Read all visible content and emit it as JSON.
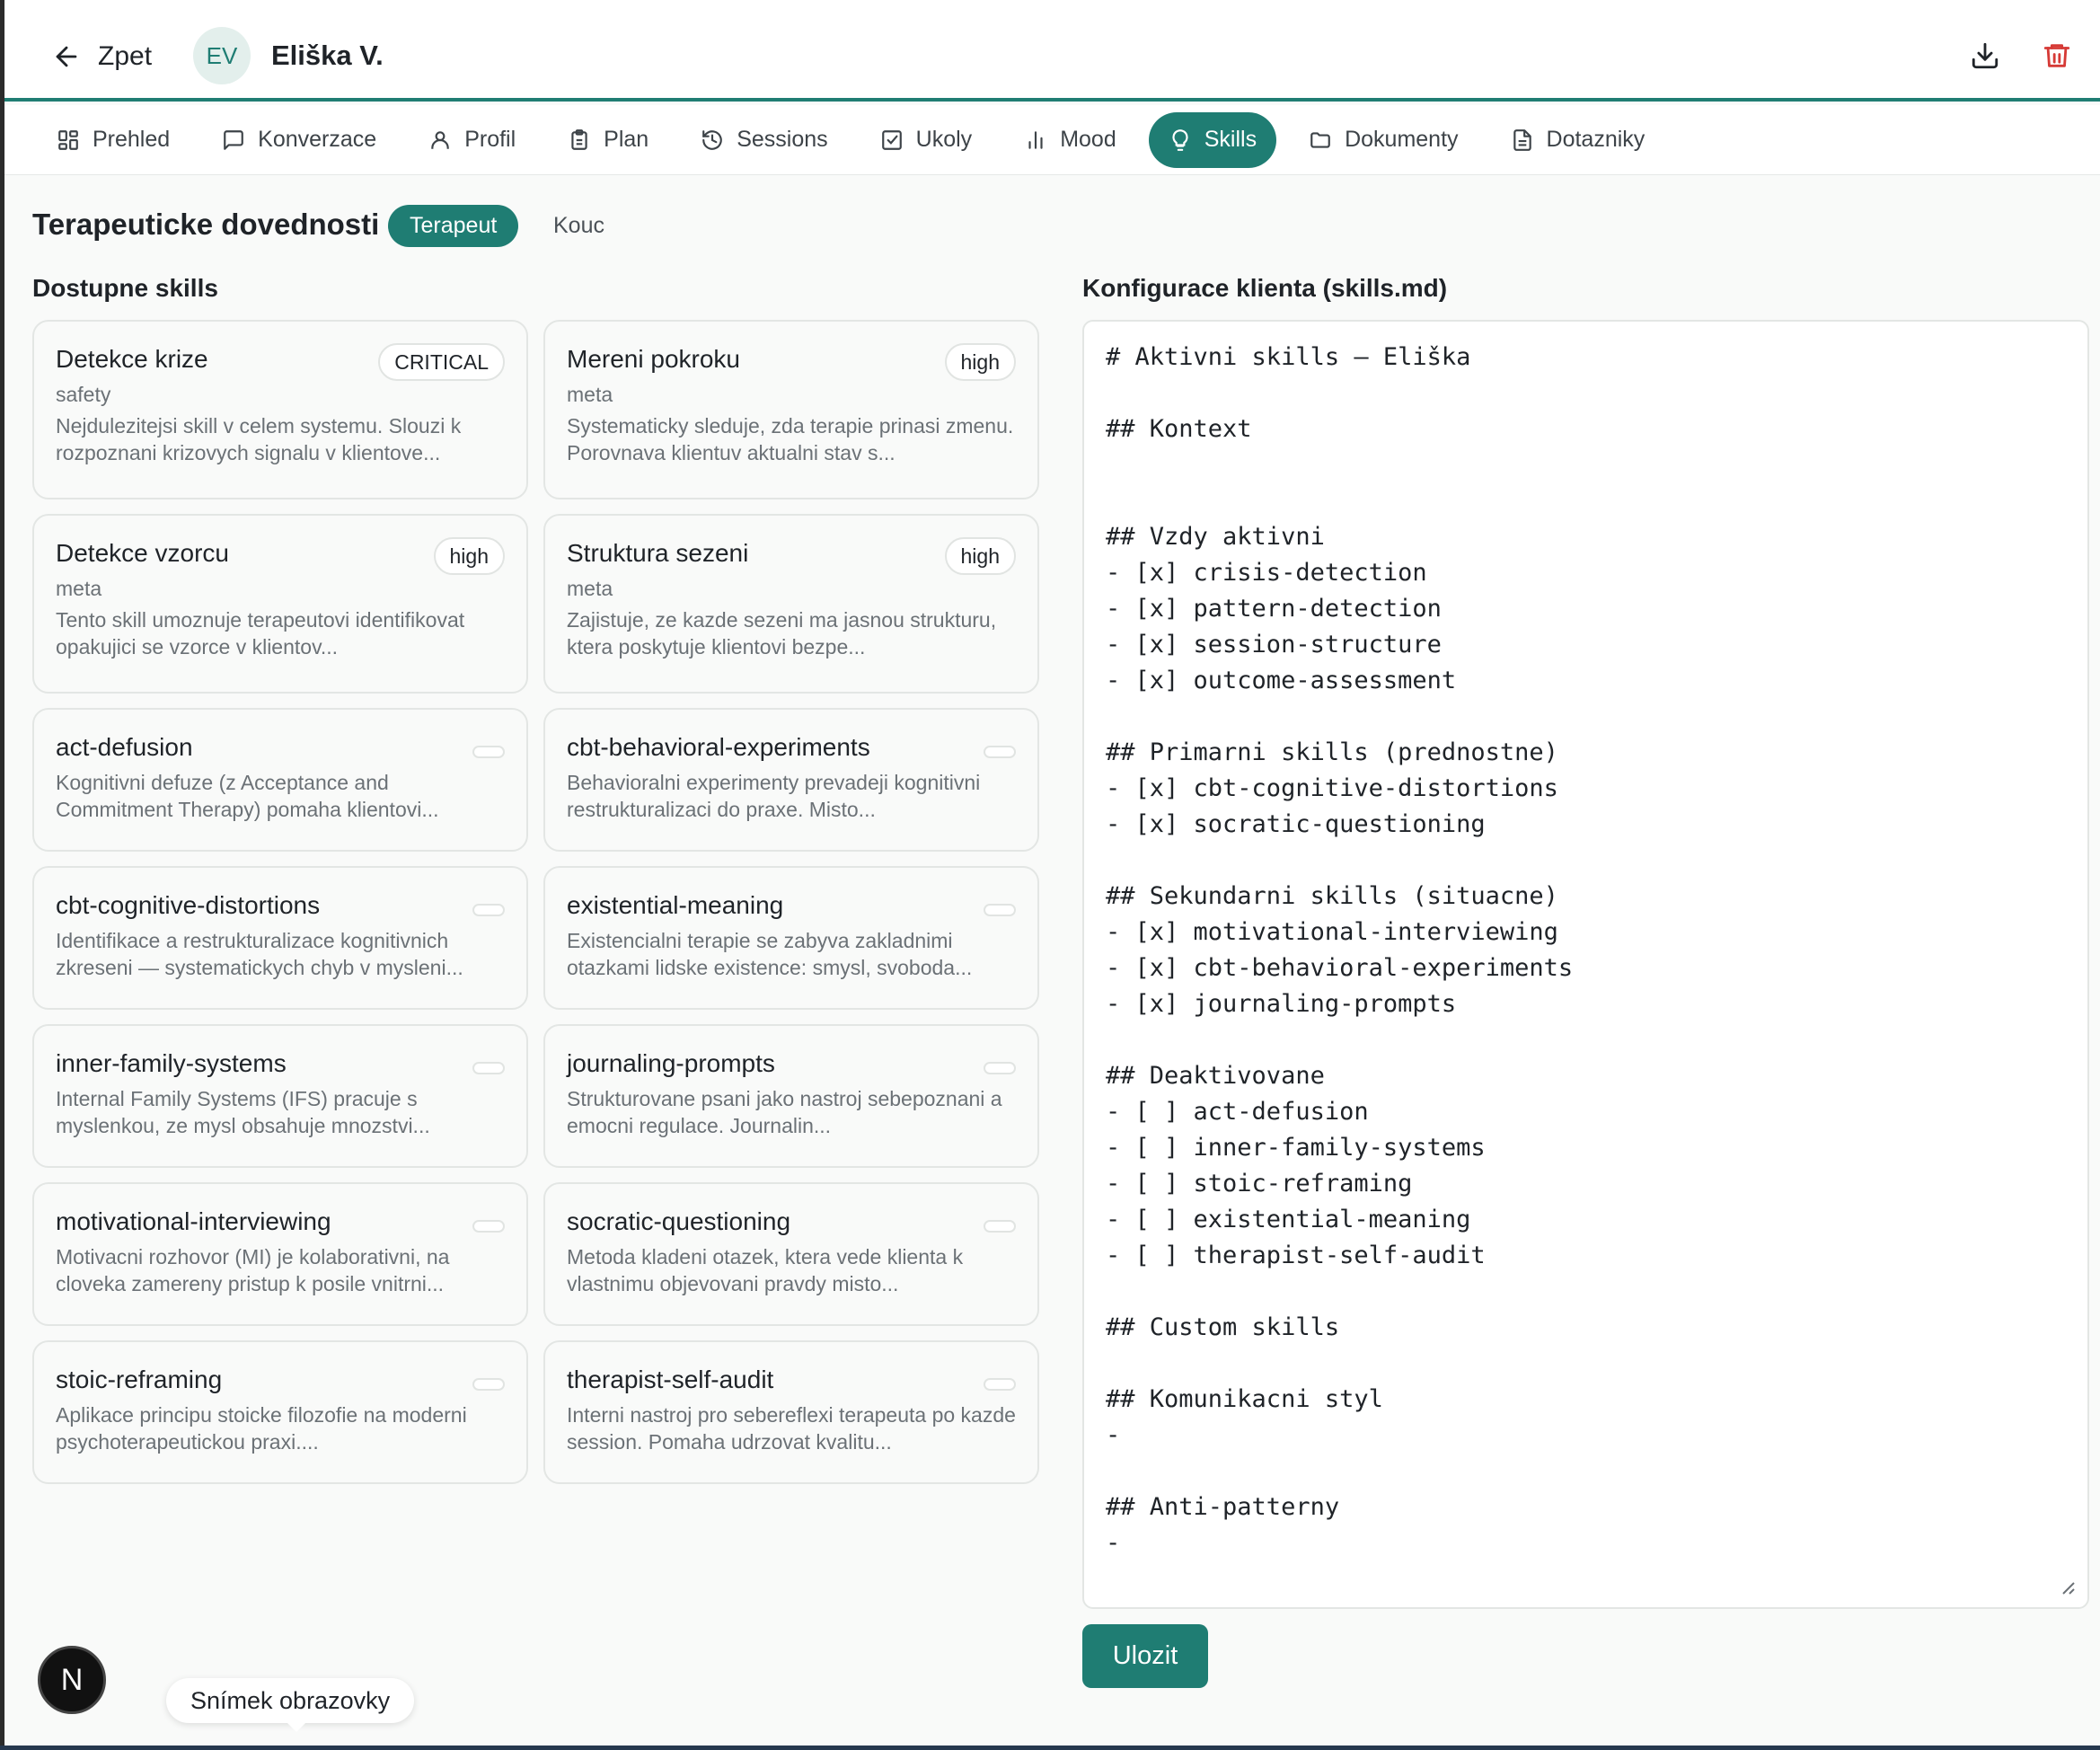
{
  "header": {
    "back_label": "Zpet",
    "avatar_initials": "EV",
    "client_name": "Eliška V.",
    "download_icon": "download-icon",
    "delete_icon": "trash-icon",
    "accent_color": "#1f7d73",
    "delete_color": "#d63a36"
  },
  "tabs": [
    {
      "label": "Prehled",
      "icon": "grid-icon"
    },
    {
      "label": "Konverzace",
      "icon": "chat-icon"
    },
    {
      "label": "Profil",
      "icon": "user-icon"
    },
    {
      "label": "Plan",
      "icon": "clipboard-icon"
    },
    {
      "label": "Sessions",
      "icon": "history-icon"
    },
    {
      "label": "Ukoly",
      "icon": "checkbox-icon"
    },
    {
      "label": "Mood",
      "icon": "bar-chart-icon"
    },
    {
      "label": "Skills",
      "icon": "lightbulb-icon",
      "active": true
    },
    {
      "label": "Dokumenty",
      "icon": "folder-icon"
    },
    {
      "label": "Dotazniky",
      "icon": "document-icon"
    }
  ],
  "page": {
    "title": "Terapeuticke dovednosti",
    "role_active": "Terapeut",
    "role_inactive": "Kouc",
    "available_title": "Dostupne skills",
    "config_title": "Konfigurace klienta (skills.md)",
    "save_label": "Ulozit"
  },
  "skills": [
    {
      "name": "Detekce krize",
      "badge": "CRITICAL",
      "category": "safety",
      "desc": "Nejdulezitejsi skill v celem systemu. Slouzi k rozpoznani krizovych signalu v klientove..."
    },
    {
      "name": "Mereni pokroku",
      "badge": "high",
      "category": "meta",
      "desc": "Systematicky sleduje, zda terapie prinasi zmenu. Porovnava klientuv aktualni stav s..."
    },
    {
      "name": "Detekce vzorcu",
      "badge": "high",
      "category": "meta",
      "desc": "Tento skill umoznuje terapeutovi identifikovat opakujici se vzorce v klientov..."
    },
    {
      "name": "Struktura sezeni",
      "badge": "high",
      "category": "meta",
      "desc": "Zajistuje, ze kazde sezeni ma jasnou strukturu, ktera poskytuje klientovi bezpe..."
    },
    {
      "name": "act-defusion",
      "desc": "Kognitivni defuze (z Acceptance and Commitment Therapy) pomaha klientovi..."
    },
    {
      "name": "cbt-behavioral-experiments",
      "desc": "Behavioralni experimenty prevadeji kognitivni restrukturalizaci do praxe. Misto..."
    },
    {
      "name": "cbt-cognitive-distortions",
      "desc": "Identifikace a restrukturalizace kognitivnich zkreseni — systematickych chyb v mysleni..."
    },
    {
      "name": "existential-meaning",
      "desc": "Existencialni terapie se zabyva zakladnimi otazkami lidske existence: smysl, svoboda..."
    },
    {
      "name": "inner-family-systems",
      "desc": "Internal Family Systems (IFS) pracuje s myslenkou, ze mysl obsahuje mnozstvi..."
    },
    {
      "name": "journaling-prompts",
      "desc": "Strukturovane psani jako nastroj sebepoznani a emocni regulace. Journalin..."
    },
    {
      "name": "motivational-interviewing",
      "desc": "Motivacni rozhovor (MI) je kolaborativni, na cloveka zamereny pristup k posile vnitrni..."
    },
    {
      "name": "socratic-questioning",
      "desc": "Metoda kladeni otazek, ktera vede klienta k vlastnimu objevovani pravdy misto..."
    },
    {
      "name": "stoic-reframing",
      "desc": "Aplikace principu stoicke filozofie na moderni psychoterapeutickou praxi...."
    },
    {
      "name": "therapist-self-audit",
      "desc": "Interni nastroj pro sebereflexi terapeuta po kazde session. Pomaha udrzovat kvalitu..."
    }
  ],
  "editor_content": "# Aktivni skills — Eliška\n\n## Kontext\n\n\n## Vzdy aktivni\n- [x] crisis-detection\n- [x] pattern-detection\n- [x] session-structure\n- [x] outcome-assessment\n\n## Primarni skills (prednostne)\n- [x] cbt-cognitive-distortions\n- [x] socratic-questioning\n\n## Sekundarni skills (situacne)\n- [x] motivational-interviewing\n- [x] cbt-behavioral-experiments\n- [x] journaling-prompts\n\n## Deaktivovane\n- [ ] act-defusion\n- [ ] inner-family-systems\n- [ ] stoic-reframing\n- [ ] existential-meaning\n- [ ] therapist-self-audit\n\n## Custom skills\n\n## Komunikacni styl\n-\n\n## Anti-patterny\n-",
  "overlay": {
    "next_badge": "N",
    "tooltip": "Snímek obrazovky"
  }
}
